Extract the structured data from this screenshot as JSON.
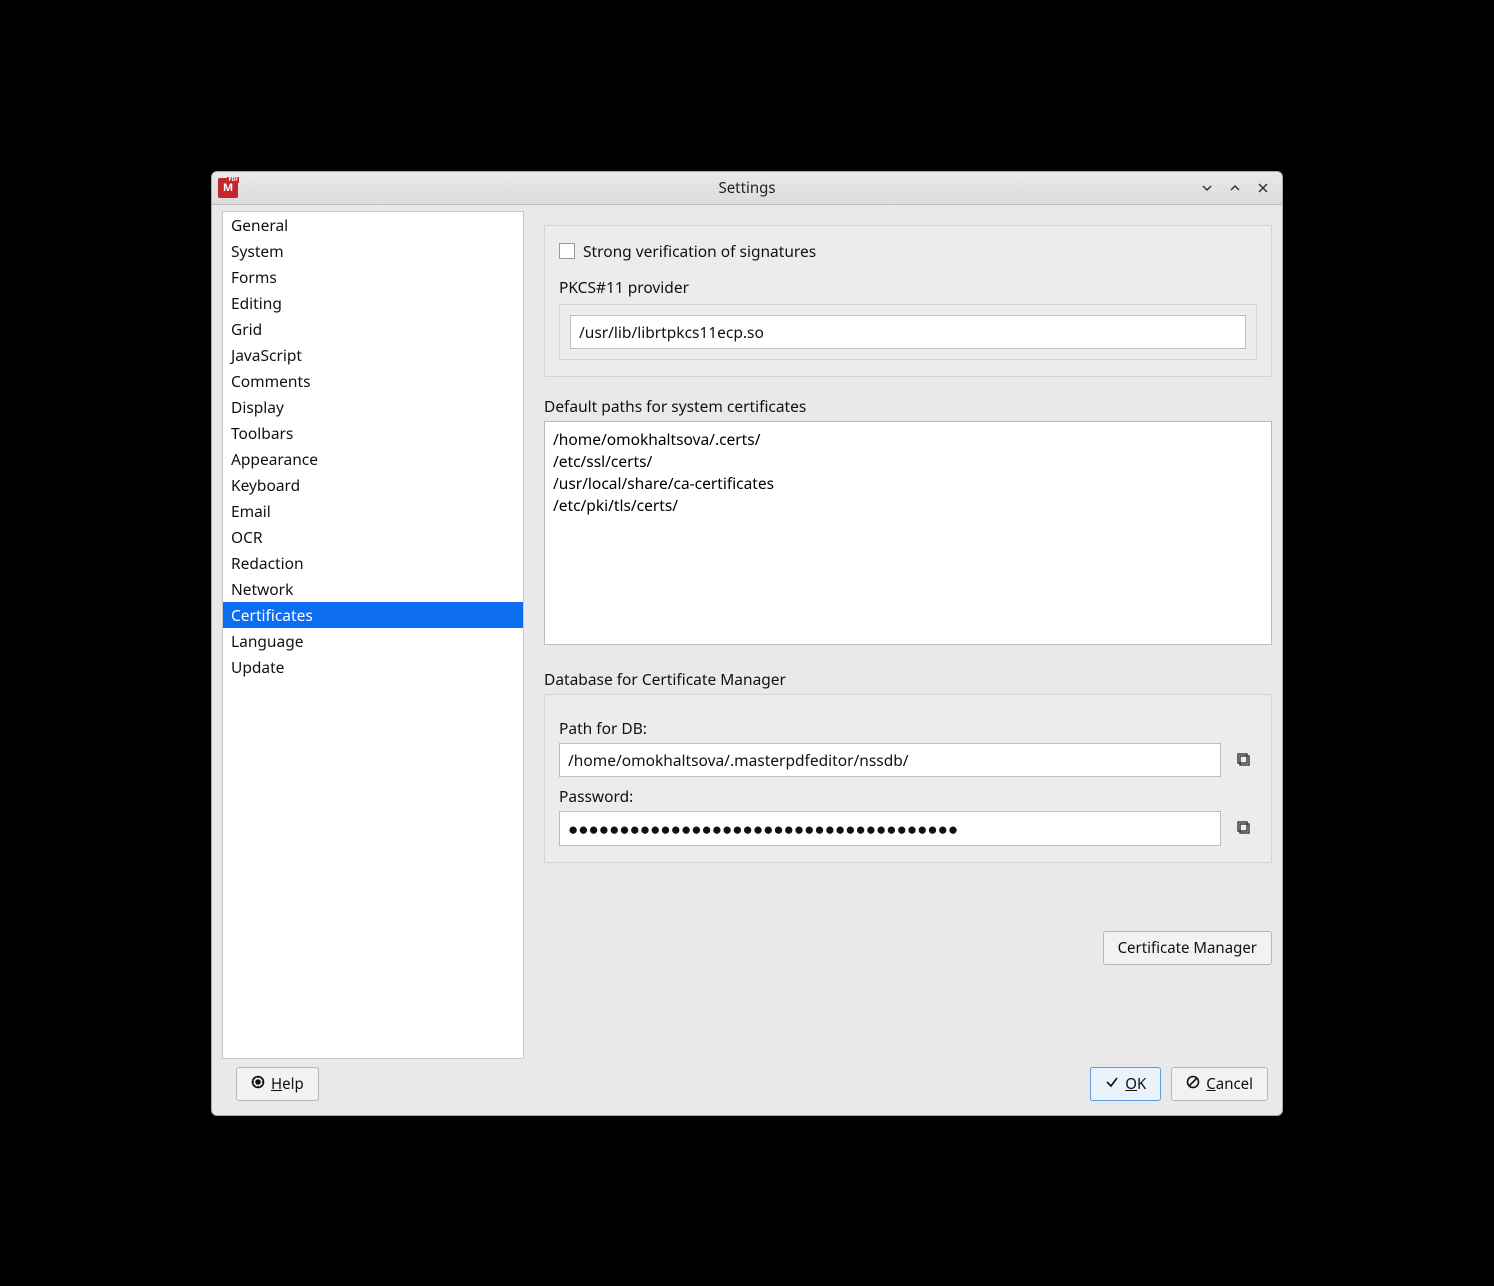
{
  "window": {
    "title": "Settings"
  },
  "sidebar": {
    "items": [
      {
        "label": "General"
      },
      {
        "label": "System"
      },
      {
        "label": "Forms"
      },
      {
        "label": "Editing"
      },
      {
        "label": "Grid"
      },
      {
        "label": "JavaScript"
      },
      {
        "label": "Comments"
      },
      {
        "label": "Display"
      },
      {
        "label": "Toolbars"
      },
      {
        "label": "Appearance"
      },
      {
        "label": "Keyboard"
      },
      {
        "label": "Email"
      },
      {
        "label": "OCR"
      },
      {
        "label": "Redaction"
      },
      {
        "label": "Network"
      },
      {
        "label": "Certificates",
        "active": true
      },
      {
        "label": "Language"
      },
      {
        "label": "Update"
      }
    ]
  },
  "certs": {
    "strong_verify_label": "Strong verification of signatures",
    "pkcs11_label": "PKCS#11 provider",
    "pkcs11_value": "/usr/lib/librtpkcs11ecp.so",
    "default_paths_label": "Default paths for system certificates",
    "default_paths_value": "/home/omokhaltsova/.certs/\n/etc/ssl/certs/\n/usr/local/share/ca-certificates\n/etc/pki/tls/certs/",
    "db_section_label": "Database for Certificate Manager",
    "path_db_label": "Path for DB:",
    "path_db_value": "/home/omokhaltsova/.masterpdfeditor/nssdb/",
    "password_label": "Password:",
    "password_value": "●●●●●●●●●●●●●●●●●●●●●●●●●●●●●●●●●●●●●●"
  },
  "buttons": {
    "cert_manager": "Certificate Manager",
    "help": "elp",
    "ok": "K",
    "cancel": "ancel"
  }
}
